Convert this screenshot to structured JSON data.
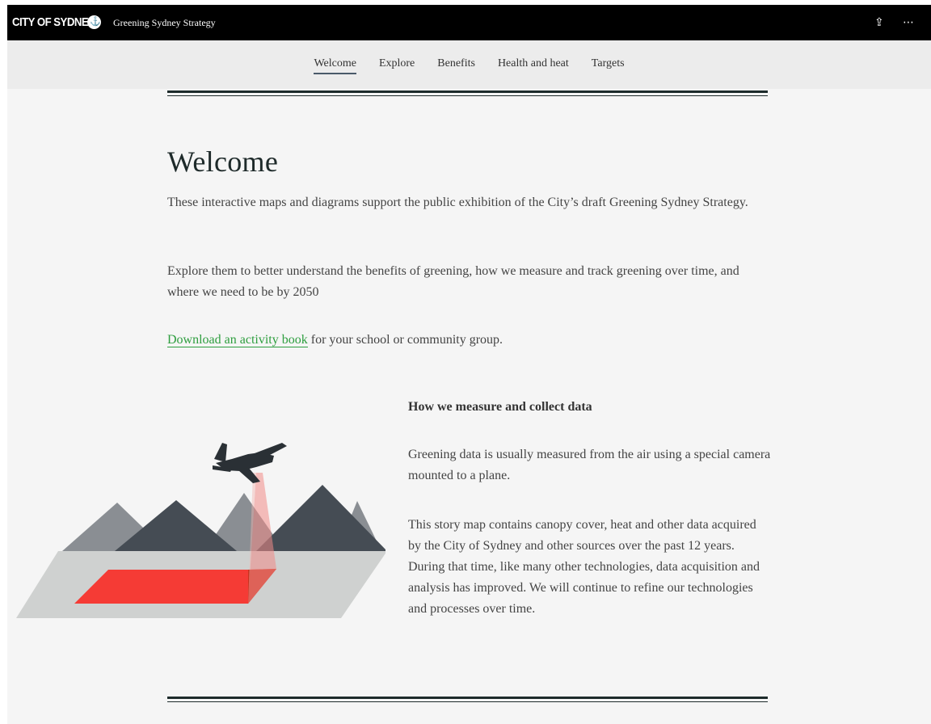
{
  "header": {
    "logo_text": "CITY OF SYDNEY",
    "site_title": "Greening Sydney Strategy",
    "share_icon": "share-icon",
    "more_icon": "more-options-icon"
  },
  "nav": {
    "items": [
      {
        "label": "Welcome",
        "active": true
      },
      {
        "label": "Explore"
      },
      {
        "label": "Benefits"
      },
      {
        "label": "Health and heat"
      },
      {
        "label": "Targets"
      }
    ]
  },
  "main": {
    "title": "Welcome",
    "para1": "These interactive maps and diagrams support the public exhibition of the City’s draft Greening Sydney Strategy.",
    "para2": "Explore them to better understand the benefits of greening, how we measure and track greening over time, and where we need to be by 2050",
    "para3_link": "Download an activity book",
    "para3_rest": " for your school or community group."
  },
  "section": {
    "heading": "How we measure and collect data",
    "para1": "Greening data is usually measured from the air using a special camera mounted to a plane.",
    "para2": "This story map contains canopy cover, heat and other data acquired by the City of Sydney and other sources over the past 12 years. During that time, like many other technologies, data acquisition and analysis has improved. We will continue to refine our technologies and processes over time."
  },
  "colors": {
    "topbar": "#000000",
    "navbar": "#ececec",
    "content_bg": "#f5f5f5",
    "link": "#2e9e3f",
    "rule": "#1d2b2b",
    "highlight_red": "#f53b35"
  }
}
